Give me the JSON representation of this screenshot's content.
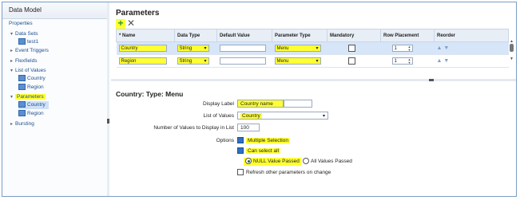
{
  "sidebar": {
    "title": "Data Model",
    "tree": [
      {
        "label": "Properties"
      },
      {
        "label": "Data Sets"
      },
      {
        "label": "test1"
      },
      {
        "label": "Event Triggers"
      },
      {
        "label": "Flexfields"
      },
      {
        "label": "List of Values"
      },
      {
        "label": "Country"
      },
      {
        "label": "Region"
      },
      {
        "label": "Parameters"
      },
      {
        "label": "Country"
      },
      {
        "label": "Region"
      },
      {
        "label": "Bursting"
      }
    ]
  },
  "parameters": {
    "heading": "Parameters",
    "columns": [
      "* Name",
      "Data Type",
      "Default Value",
      "Parameter Type",
      "Mandatory",
      "Row Placement",
      "Reorder"
    ],
    "rows": [
      {
        "name": "Country",
        "data_type": "String",
        "default_value": "",
        "parameter_type": "Menu",
        "row_placement": "1"
      },
      {
        "name": "Region",
        "data_type": "String",
        "default_value": "",
        "parameter_type": "Menu",
        "row_placement": "1"
      }
    ]
  },
  "detail": {
    "title": "Country: Type: Menu",
    "display_label_label": "Display Label",
    "display_label_value": "Country name",
    "list_of_values_label": "List of Values",
    "list_of_values_value": "Country",
    "num_values_label": "Number of Values to Display in List",
    "num_values_value": "100",
    "options_label": "Options",
    "multiple_selection": "Multiple Selection",
    "can_select_all": "Can select all",
    "null_value_passed": "NULL Value Passed",
    "all_values_passed": "All Values Passed",
    "refresh_other": "Refresh other parameters on change"
  },
  "colors": {
    "highlight": "#ffff33",
    "accent": "#1f4e8c"
  }
}
